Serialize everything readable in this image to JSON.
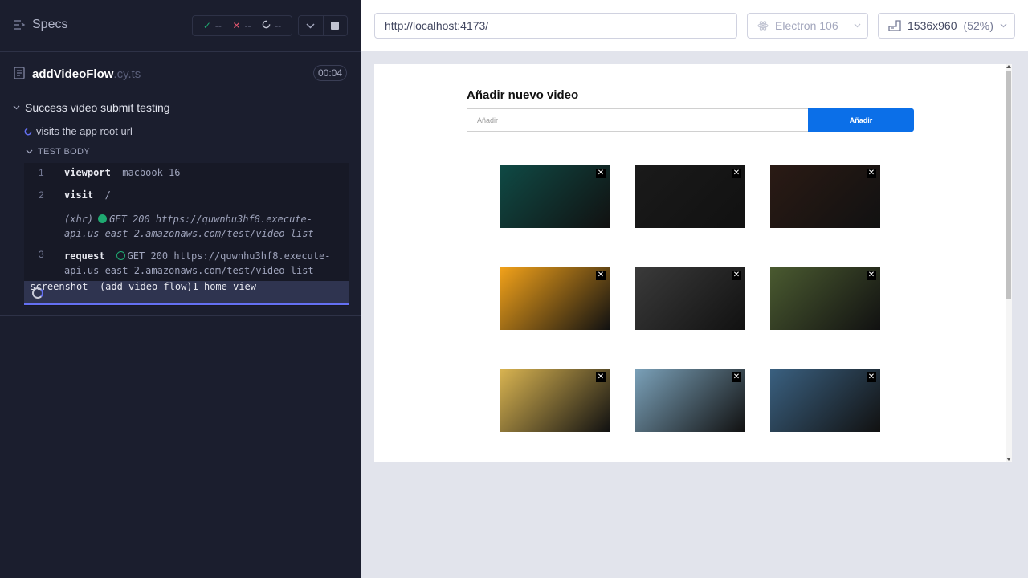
{
  "reporter": {
    "header": {
      "specs_label": "Specs",
      "passed": "--",
      "failed": "--",
      "pending": "--"
    },
    "spec_file": {
      "name": "addVideoFlow",
      "ext": ".cy.ts",
      "duration": "00:04"
    },
    "suite_title": "Success video submit testing",
    "test_title": "visits the app root url",
    "test_body_label": "TEST BODY",
    "commands": [
      {
        "num": "1",
        "name": "viewport",
        "arg": "macbook-16"
      },
      {
        "num": "2",
        "name": "visit",
        "arg": "/"
      },
      {
        "num": "",
        "name": "(xhr)",
        "arg": "GET 200 https://quwnhu3hf8.execute-api.us-east-2.amazonaws.com/test/video-list"
      },
      {
        "num": "3",
        "name": "request",
        "arg": "GET 200 https://quwnhu3hf8.execute-api.us-east-2.amazonaws.com/test/video-list"
      },
      {
        "num": "",
        "name": "-screenshot",
        "arg": "(add-video-flow)1-home-view"
      }
    ]
  },
  "preview": {
    "url": "http://localhost:4173/",
    "browser": "Electron 106",
    "viewport": "1536x960",
    "scale": "(52%)"
  },
  "app": {
    "title": "Añadir nuevo video",
    "input_placeholder": "Añadir",
    "button_label": "Añadir",
    "close_glyph": "✕",
    "videos": [
      {
        "bg": "#0f4a45"
      },
      {
        "bg": "#1a1a1a"
      },
      {
        "bg": "#2a1a14"
      },
      {
        "bg": "#f2a21a"
      },
      {
        "bg": "#3a3a3a"
      },
      {
        "bg": "#4a5a30"
      },
      {
        "bg": "#d9b451"
      },
      {
        "bg": "#7aa0b8"
      },
      {
        "bg": "#3a6080"
      }
    ]
  },
  "colors": {
    "accent": "#0b6fe8",
    "pass": "#1fa971",
    "fail": "#e45770",
    "active": "#6470f3"
  }
}
